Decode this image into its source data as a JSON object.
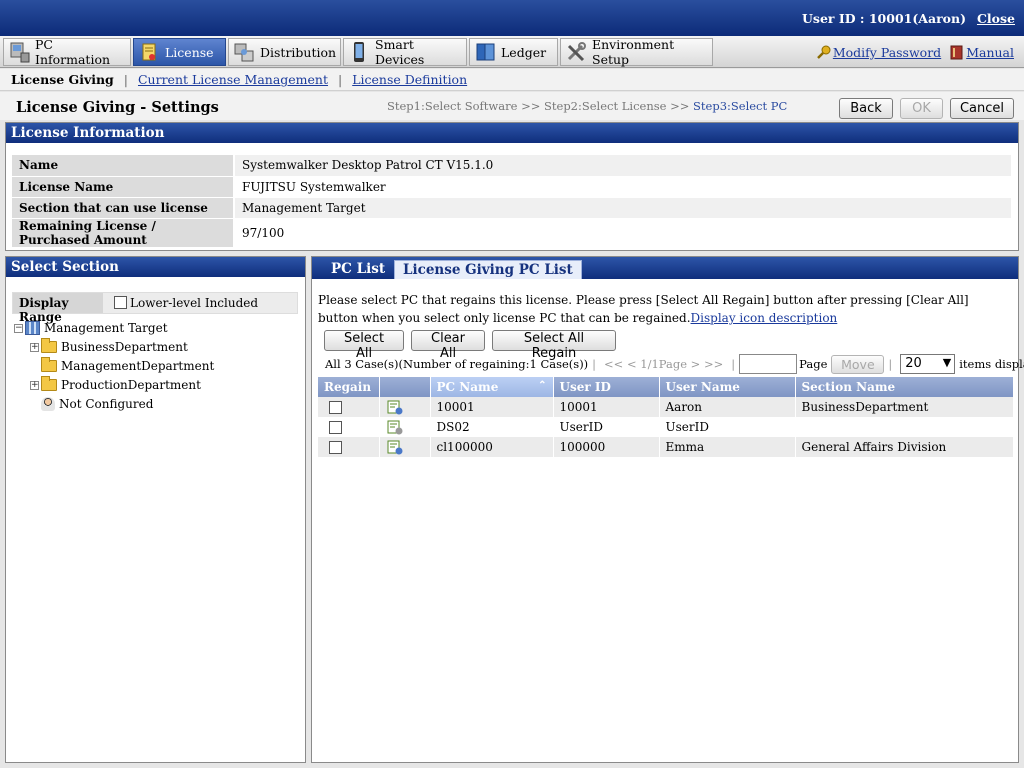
{
  "header": {
    "user_id": "User ID : 10001(Aaron)",
    "close": "Close"
  },
  "menu": [
    {
      "label": "PC Information",
      "icon": "pc-icon"
    },
    {
      "label": "License",
      "icon": "license-icon"
    },
    {
      "label": "Distribution",
      "icon": "distribution-icon"
    },
    {
      "label": "Smart Devices",
      "icon": "smartphone-icon"
    },
    {
      "label": "Ledger",
      "icon": "ledger-icon"
    },
    {
      "label": "Environment Setup",
      "icon": "tools-icon"
    }
  ],
  "right_links": {
    "modify_password": "Modify Password",
    "manual": "Manual"
  },
  "subnav": {
    "current": "License Giving",
    "link1": "Current License Management",
    "link2": "License Definition"
  },
  "page": {
    "title": "License Giving - Settings",
    "step1": "Step1:Select Software >>",
    "step2": "Step2:Select License >>",
    "step3": "Step3:Select PC",
    "back": "Back",
    "ok": "OK",
    "cancel": "Cancel"
  },
  "license_info": {
    "header": "License Information",
    "rows": [
      {
        "key": "Name",
        "value": "Systemwalker Desktop Patrol CT V15.1.0"
      },
      {
        "key": "License Name",
        "value": "FUJITSU Systemwalker"
      },
      {
        "key": "Section that can use license",
        "value": "Management Target"
      },
      {
        "key": "Remaining License / Purchased Amount",
        "value": "97/100"
      }
    ]
  },
  "section": {
    "header": "Select Section",
    "display_range": "Display Range",
    "lower_level": "Lower-level Included",
    "tree": {
      "root": "Management Target",
      "children": [
        "BusinessDepartment",
        "ManagementDepartment",
        "ProductionDepartment",
        "Not Configured"
      ]
    }
  },
  "pclist": {
    "tab1": "PC List",
    "tab2": "License Giving PC List",
    "desc": "Please select PC that regains this license. Please press [Select All Regain] button after pressing [Clear All] button when you select only license PC that can be regained.",
    "desc_link": "Display icon description",
    "select_all": "Select All",
    "clear_all": "Clear All",
    "select_all_regain": "Select All Regain",
    "count": "All 3 Case(s)(Number of regaining:1 Case(s))",
    "nav": "<< < 1/1Page > >>",
    "page_label": "Page",
    "move": "Move",
    "per_page": "20",
    "items_displayed": "items displayed",
    "columns": [
      "Regain",
      "",
      "PC Name",
      "User ID",
      "User Name",
      "Section Name"
    ],
    "rows": [
      {
        "pc": "10001",
        "uid": "10001",
        "uname": "Aaron",
        "section": "BusinessDepartment"
      },
      {
        "pc": "DS02",
        "uid": "UserID",
        "uname": "UserID",
        "section": ""
      },
      {
        "pc": "cl100000",
        "uid": "100000",
        "uname": "Emma",
        "section": "General Affairs Division"
      }
    ]
  }
}
